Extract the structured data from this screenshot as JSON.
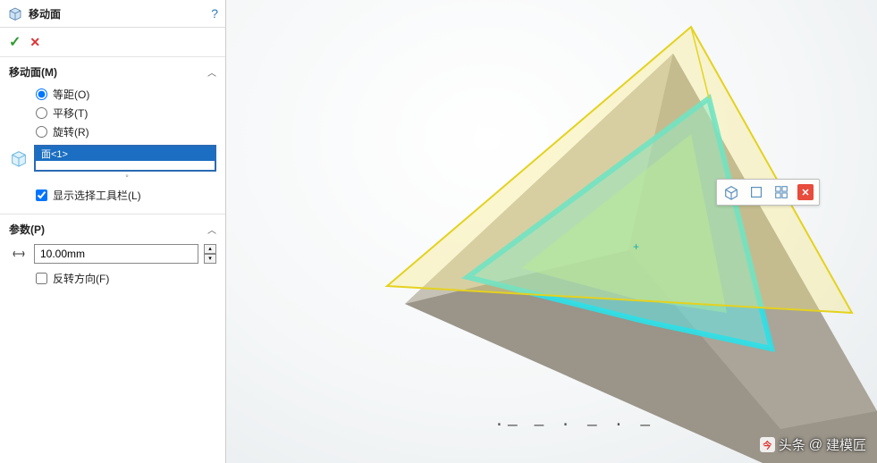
{
  "panel": {
    "title": "移动面",
    "help_symbol": "?",
    "ok_symbol": "✓",
    "cancel_symbol": "✕",
    "move_face": {
      "heading": "移动面(M)",
      "options": {
        "offset": "等距(O)",
        "translate": "平移(T)",
        "rotate": "旋转(R)"
      },
      "selected": "offset",
      "face_label": "面<1>",
      "show_toolbar": "显示选择工具栏(L)",
      "show_toolbar_checked": true
    },
    "params": {
      "heading": "参数(P)",
      "distance": "10.00mm",
      "reverse": "反转方向(F)",
      "reverse_checked": false
    }
  },
  "context_toolbar": {
    "icon1": "view-iso",
    "icon2": "view-single",
    "icon3": "view-multi",
    "close": "✕"
  },
  "watermark": {
    "prefix": "头条",
    "at": "@",
    "author": "建模匠"
  }
}
